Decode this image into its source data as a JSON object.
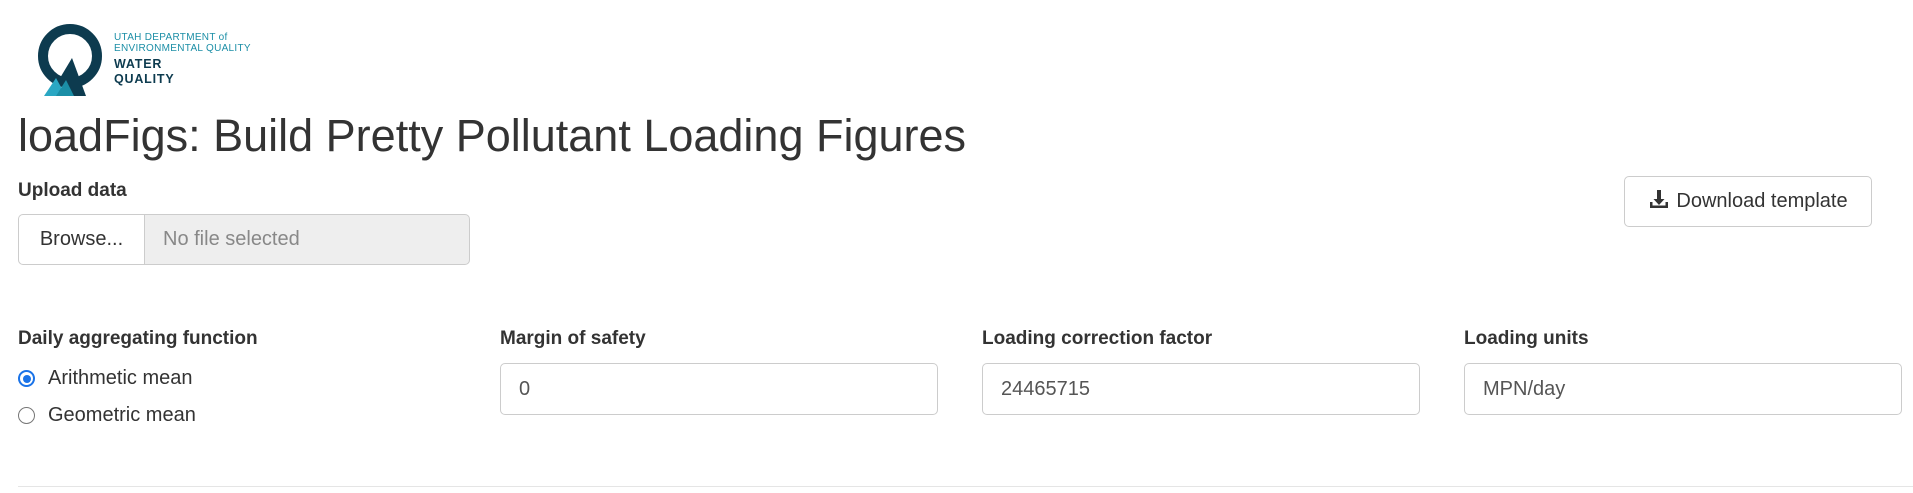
{
  "logo": {
    "line1": "UTAH DEPARTMENT of",
    "line2": "ENVIRONMENTAL QUALITY",
    "line3": "WATER",
    "line4": "QUALITY",
    "colors": {
      "dark": "#0d3b4f",
      "teal": "#1b8ea6",
      "light": "#2aa7c3"
    }
  },
  "page_title": "loadFigs: Build Pretty Pollutant Loading Figures",
  "upload": {
    "label": "Upload data",
    "browse_label": "Browse...",
    "file_placeholder": "No file selected"
  },
  "download_template": {
    "label": "Download template",
    "icon": "download-icon"
  },
  "aggregation": {
    "label": "Daily aggregating function",
    "options": [
      {
        "label": "Arithmetic mean",
        "selected": true
      },
      {
        "label": "Geometric mean",
        "selected": false
      }
    ],
    "accent": "#1a73e8"
  },
  "margin_of_safety": {
    "label": "Margin of safety",
    "value": "0"
  },
  "loading_correction_factor": {
    "label": "Loading correction factor",
    "value": "24465715"
  },
  "loading_units": {
    "label": "Loading units",
    "value": "MPN/day"
  }
}
